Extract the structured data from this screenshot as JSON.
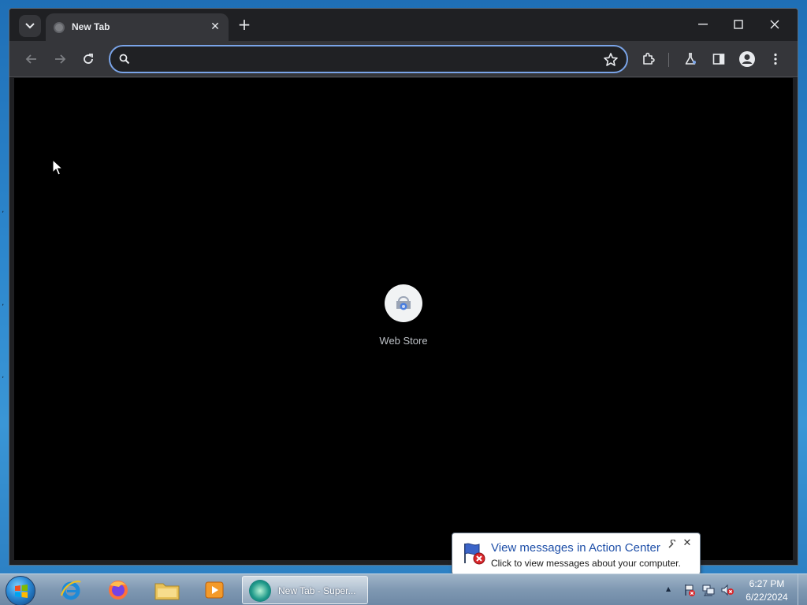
{
  "browser": {
    "tab": {
      "title": "New Tab",
      "favicon": "globe-icon"
    },
    "toolbar": {
      "omnibox_value": "",
      "omnibox_placeholder": ""
    },
    "shortcuts": [
      {
        "label": "Web Store",
        "icon": "web-store-icon"
      }
    ],
    "colors": {
      "accent": "#7aa4e8",
      "frame": "#1f2023",
      "toolbar": "#35363a",
      "page": "#000000"
    }
  },
  "notification": {
    "title": "View messages in Action Center",
    "text": "Click to view messages about your computer."
  },
  "taskbar": {
    "pinned": [
      "internet-explorer-icon",
      "firefox-icon",
      "file-explorer-icon",
      "media-player-icon"
    ],
    "active_task_label": "New Tab - Super...",
    "clock": {
      "time": "6:27 PM",
      "date": "6/22/2024"
    }
  }
}
